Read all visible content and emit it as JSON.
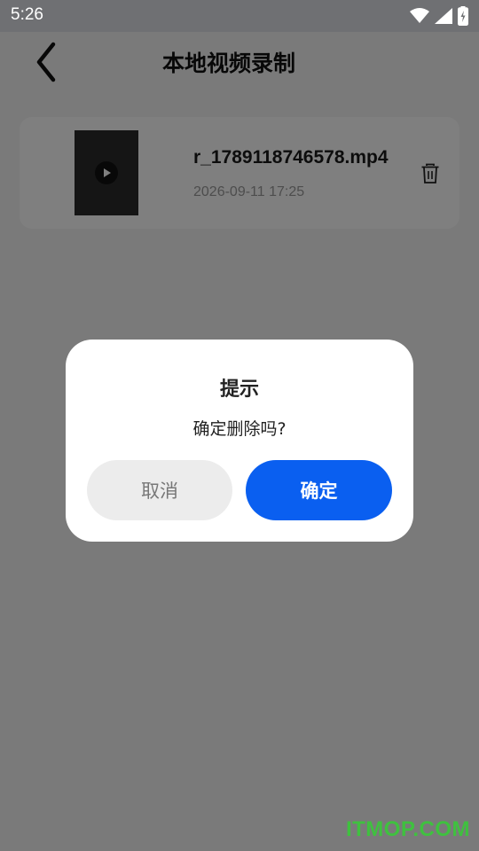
{
  "status_bar": {
    "time": "5:26",
    "icons": [
      "wifi-icon",
      "cellular-signal-icon",
      "battery-charging-icon"
    ]
  },
  "header": {
    "title": "本地视频录制",
    "back_icon": "chevron-left-icon"
  },
  "video_list": [
    {
      "file_name": "r_1789118746578.mp4",
      "date": "2026-09-11 17:25",
      "thumbnail_icon": "play-icon",
      "delete_icon": "trash-icon"
    }
  ],
  "dialog": {
    "title": "提示",
    "message": "确定删除吗?",
    "cancel_label": "取消",
    "confirm_label": "确定"
  },
  "watermark": "ITMOP.COM",
  "colors": {
    "confirm_button": "#0a5ff0",
    "cancel_button": "#ececec",
    "overlay": "rgba(0,0,0,0.5)",
    "watermark": "#3fc13f"
  }
}
